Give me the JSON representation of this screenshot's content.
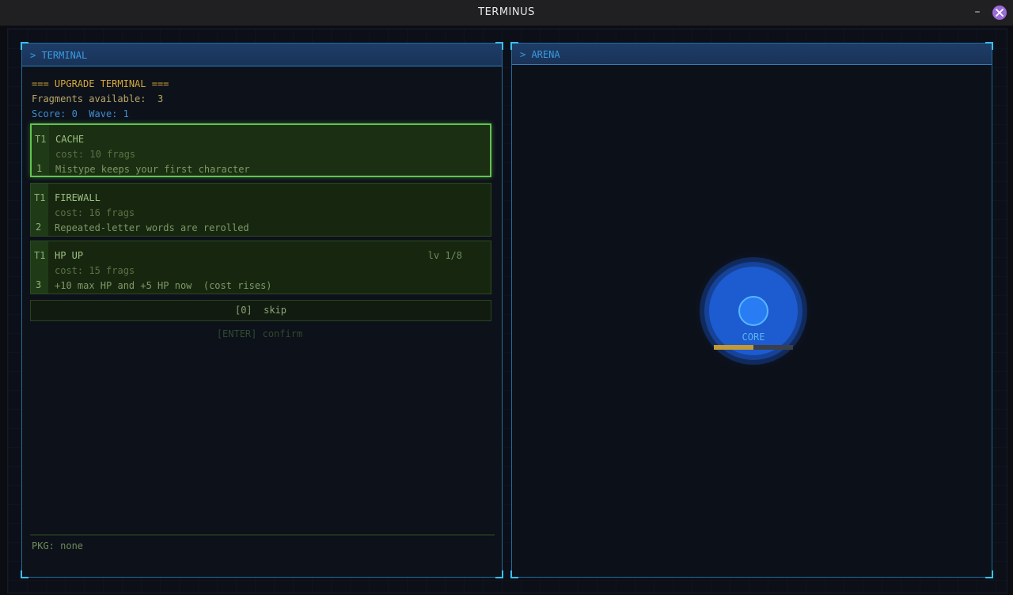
{
  "window": {
    "title": "TERMINUS"
  },
  "terminal": {
    "header": "> TERMINAL",
    "heading": "=== UPGRADE TERMINAL ===",
    "fragments_label": "Fragments available:",
    "fragments": "3",
    "score_label": "Score:",
    "score": "0",
    "wave_label": "Wave:",
    "wave": "1",
    "upgrades": [
      {
        "tier": "T1",
        "key": "1",
        "name": "CACHE",
        "cost": "cost: 10 frags",
        "desc": "Mistype keeps your first character",
        "level": "",
        "selected": true
      },
      {
        "tier": "T1",
        "key": "2",
        "name": "FIREWALL",
        "cost": "cost: 16 frags",
        "desc": "Repeated-letter words are rerolled",
        "level": "",
        "selected": false
      },
      {
        "tier": "T1",
        "key": "3",
        "name": "HP UP",
        "cost": "cost: 15 frags",
        "desc": "+10 max HP and +5 HP now  (cost rises)",
        "level": "lv 1/8",
        "selected": false
      }
    ],
    "skip": "[0]  skip",
    "confirm": "[ENTER] confirm",
    "pkg": "PKG: none"
  },
  "arena": {
    "header": "> ARENA",
    "core_label": "CORE",
    "core_hp_fraction": 0.5
  },
  "colors": {
    "accent": "#1f6d9e",
    "selected": "#62c450",
    "core": "#1f6fe0",
    "hp": "#c49a36"
  }
}
